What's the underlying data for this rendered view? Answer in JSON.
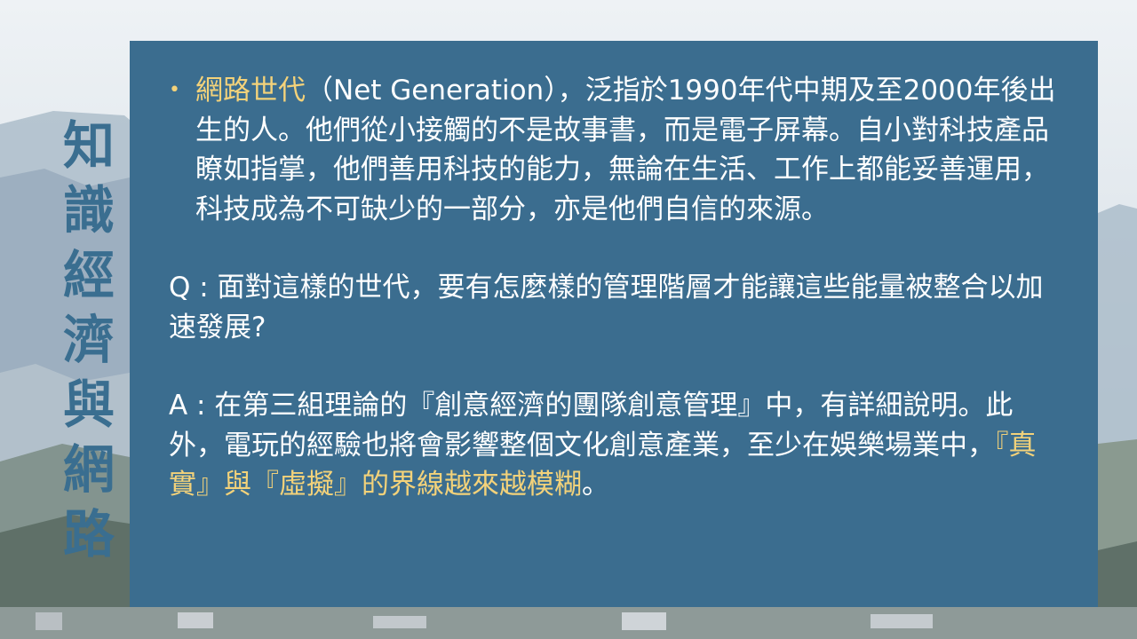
{
  "slide": {
    "side_title": [
      "知",
      "識",
      "經",
      "濟",
      "與",
      "網",
      "路"
    ],
    "bullet": {
      "highlight": "網路世代",
      "text": "（Net Generation），泛指於1990年代中期及至2000年後出生的人。他們從小接觸的不是故事書，而是電子屏幕。自小對科技產品瞭如指掌，他們善用科技的能力，無論在生活、工作上都能妥善運用，科技成為不可缺少的一部分，亦是他們自信的來源。"
    },
    "question": "Q : 面對這樣的世代，要有怎麼樣的管理階層才能讓這些能量被整合以加速發展?",
    "answer": {
      "text": "A : 在第三組理論的『創意經濟的團隊創意管理』中，有詳細說明。此外，電玩的經驗也將會影響整個文化創意產業，至少在娛樂場業中，",
      "highlight": "『真實』與『虛擬』的界線越來越模糊",
      "end": "。"
    }
  },
  "colors": {
    "panel": "#3b6d8f",
    "side_title": "#3a6e90",
    "highlight": "#f3d27a",
    "text": "#ffffff"
  }
}
